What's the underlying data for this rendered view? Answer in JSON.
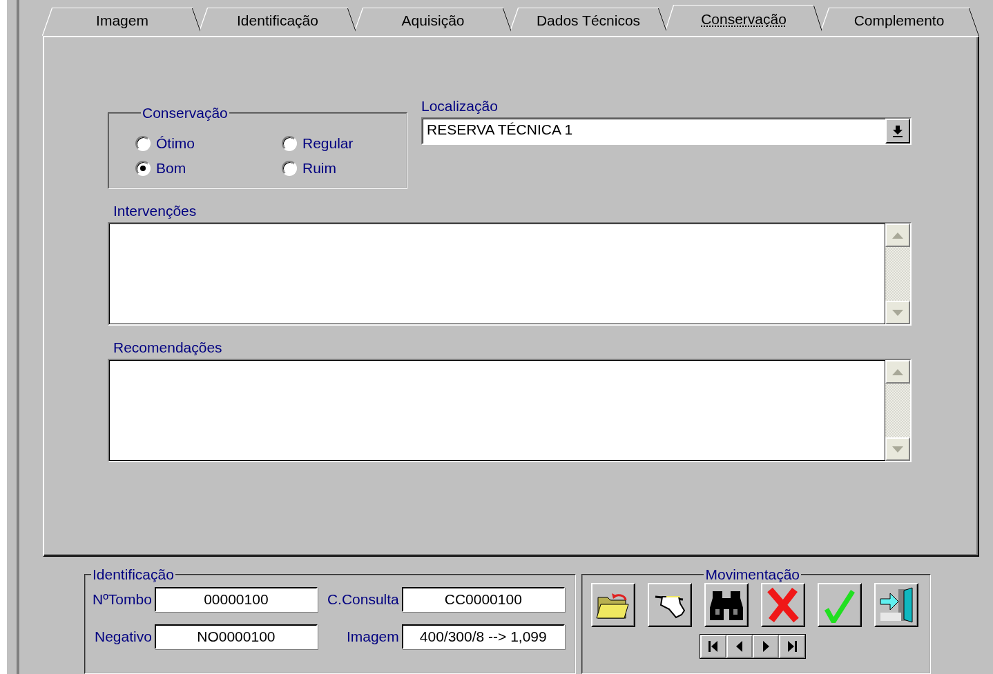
{
  "tabs": [
    {
      "label": "Imagem",
      "selected": false
    },
    {
      "label": "Identificação",
      "selected": false
    },
    {
      "label": "Aquisição",
      "selected": false
    },
    {
      "label": "Dados Técnicos",
      "selected": false
    },
    {
      "label": "Conservação",
      "selected": true
    },
    {
      "label": "Complemento",
      "selected": false
    }
  ],
  "conservation": {
    "title": "Conservação",
    "options": [
      {
        "label": "Ótimo",
        "selected": false
      },
      {
        "label": "Bom",
        "selected": true
      },
      {
        "label": "Regular",
        "selected": false
      },
      {
        "label": "Ruim",
        "selected": false
      }
    ]
  },
  "location": {
    "label": "Localização",
    "value": "RESERVA TÉCNICA 1"
  },
  "interventions": {
    "label": "Intervenções"
  },
  "recommendations": {
    "label": "Recomendações"
  },
  "identification": {
    "title": "Identificação",
    "fields": [
      {
        "label": "NºTombo",
        "value": "00000100"
      },
      {
        "label": "C.Consulta",
        "value": "CC0000100"
      },
      {
        "label": "Negativo",
        "value": "NO0000100"
      },
      {
        "label": "Imagem",
        "value": "400/300/8 --> 1,099"
      }
    ]
  },
  "movement": {
    "title": "Movimentação",
    "buttons": [
      {
        "kind": "open"
      },
      {
        "kind": "edit"
      },
      {
        "kind": "find"
      },
      {
        "kind": "delete"
      },
      {
        "kind": "confirm"
      },
      {
        "kind": "exit"
      }
    ],
    "nav": [
      {
        "kind": "first"
      },
      {
        "kind": "prev"
      },
      {
        "kind": "next"
      },
      {
        "kind": "last"
      }
    ]
  }
}
